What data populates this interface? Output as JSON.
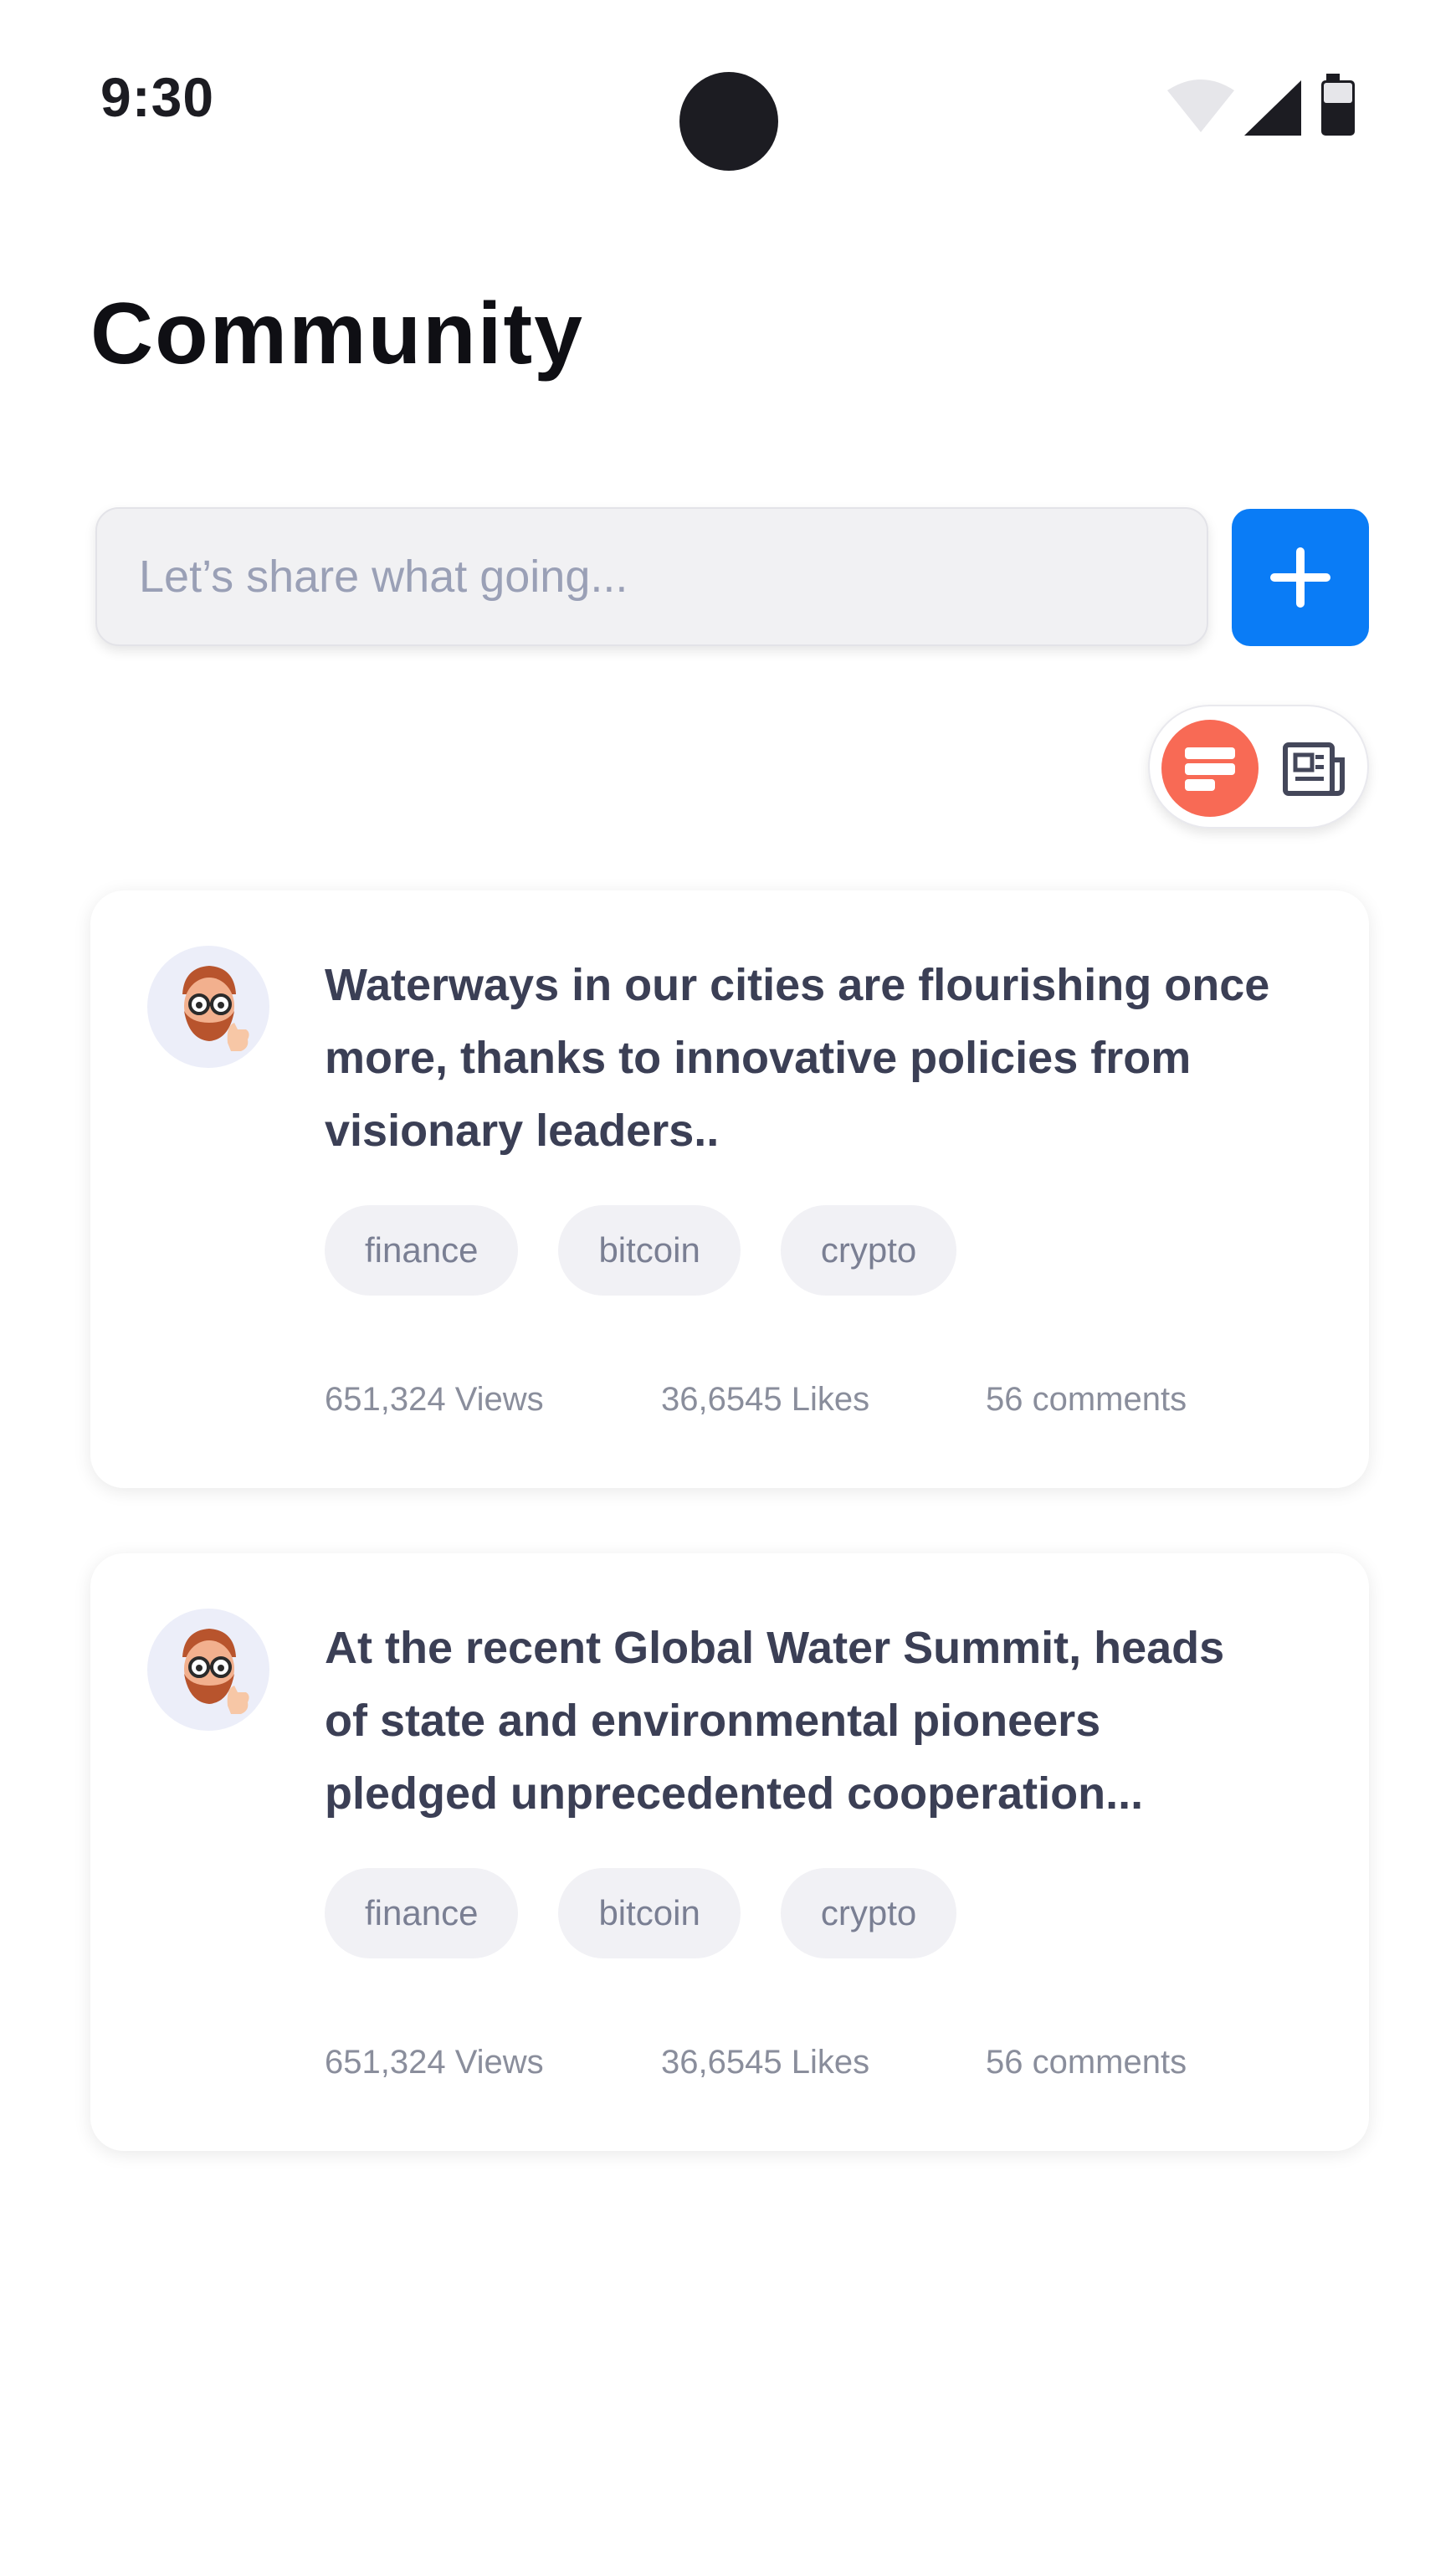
{
  "status_bar": {
    "time": "9:30",
    "icons": [
      "wifi-icon",
      "signal-icon",
      "battery-icon"
    ]
  },
  "page": {
    "title": "Community"
  },
  "composer": {
    "placeholder": "Let’s share what going...",
    "add_icon": "plus-icon"
  },
  "view_toggle": {
    "options": [
      "list-view-icon",
      "newspaper-view-icon"
    ],
    "active": "list-view-icon"
  },
  "posts": [
    {
      "text": "Waterways in our cities are flourishing once more, thanks to innovative policies from visionary leaders..",
      "tags": [
        "finance",
        "bitcoin",
        "crypto"
      ],
      "views": "651,324 Views",
      "likes": "36,6545 Likes",
      "comments": "56 comments"
    },
    {
      "text": "At the recent Global Water Summit, heads of state and environmental pioneers pledged unprecedented cooperation...",
      "tags": [
        "finance",
        "bitcoin",
        "crypto"
      ],
      "views": "651,324 Views",
      "likes": "36,6545 Likes",
      "comments": "56 comments"
    }
  ],
  "colors": {
    "accent_blue": "#0a7cf6",
    "toggle_active": "#f86a55",
    "text_primary": "#3b3f55",
    "text_muted": "#8a8e9c",
    "tag_bg": "#f1f1f5"
  }
}
